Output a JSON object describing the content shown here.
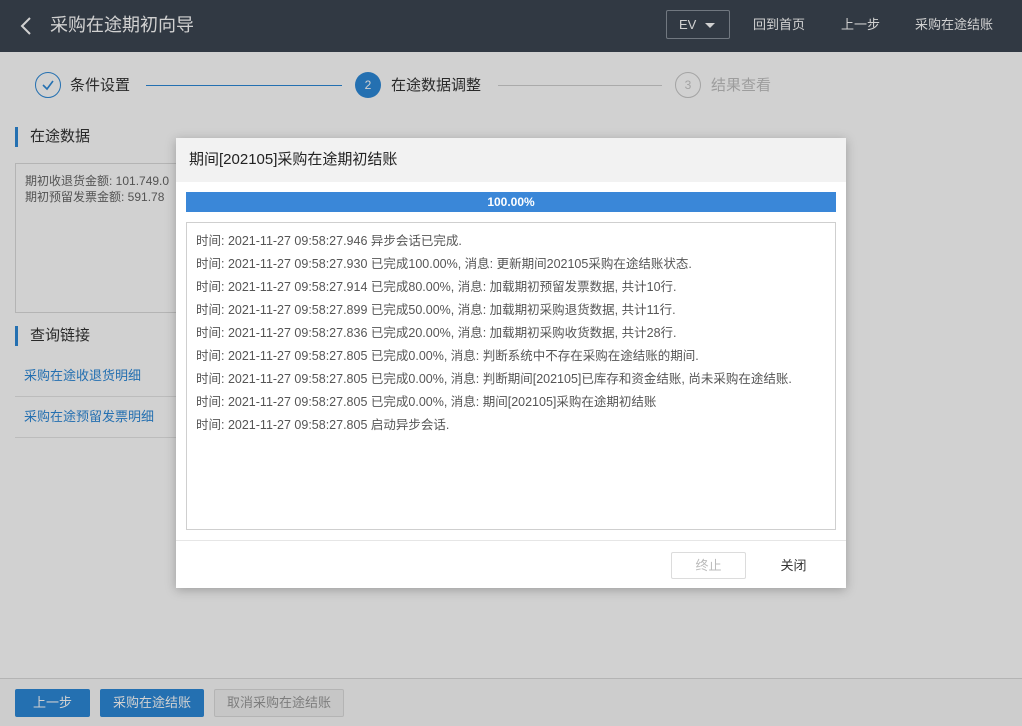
{
  "header": {
    "title": "采购在途期初向导",
    "ev_select": "EV",
    "links": [
      "回到首页",
      "上一步",
      "采购在途结账"
    ]
  },
  "steps": [
    {
      "number": "",
      "label": "条件设置",
      "state": "done"
    },
    {
      "number": "2",
      "label": "在途数据调整",
      "state": "active"
    },
    {
      "number": "3",
      "label": "结果查看",
      "state": "todo"
    }
  ],
  "left": {
    "section1_title": "在途数据",
    "data_lines": [
      "期初收退货金额: 101.749.0",
      "期初预留发票金额: 591.78"
    ],
    "section2_title": "查询链接",
    "links": [
      "采购在途收退货明细",
      "采购在途预留发票明细"
    ]
  },
  "bottom": {
    "prev_label": "上一步",
    "close_label": "采购在途结账",
    "cancel_label": "取消采购在途结账"
  },
  "dialog": {
    "title": "期间[202105]采购在途期初结账",
    "progress_percent": 100,
    "progress_text": "100.00%",
    "log": [
      "时间: 2021-11-27 09:58:27.946 异步会话已完成.",
      "时间: 2021-11-27 09:58:27.930 已完成100.00%, 消息: 更新期间202105采购在途结账状态.",
      "时间: 2021-11-27 09:58:27.914 已完成80.00%, 消息: 加载期初预留发票数据, 共计10行.",
      "时间: 2021-11-27 09:58:27.899 已完成50.00%, 消息: 加载期初采购退货数据, 共计11行.",
      "时间: 2021-11-27 09:58:27.836 已完成20.00%, 消息: 加载期初采购收货数据, 共计28行.",
      "时间: 2021-11-27 09:58:27.805 已完成0.00%, 消息: 判断系统中不存在采购在途结账的期间.",
      "时间: 2021-11-27 09:58:27.805 已完成0.00%, 消息: 判断期间[202105]已库存和资金结账, 尚未采购在途结账.",
      "时间: 2021-11-27 09:58:27.805 已完成0.00%, 消息: 期间[202105]采购在途期初结账",
      "时间: 2021-11-27 09:58:27.805 启动异步会话."
    ],
    "stop_label": "终止",
    "close_label": "关闭"
  },
  "colors": {
    "accent": "#2d89d8",
    "header_bg": "#3c4652",
    "progress_fill": "#3a87d8"
  }
}
